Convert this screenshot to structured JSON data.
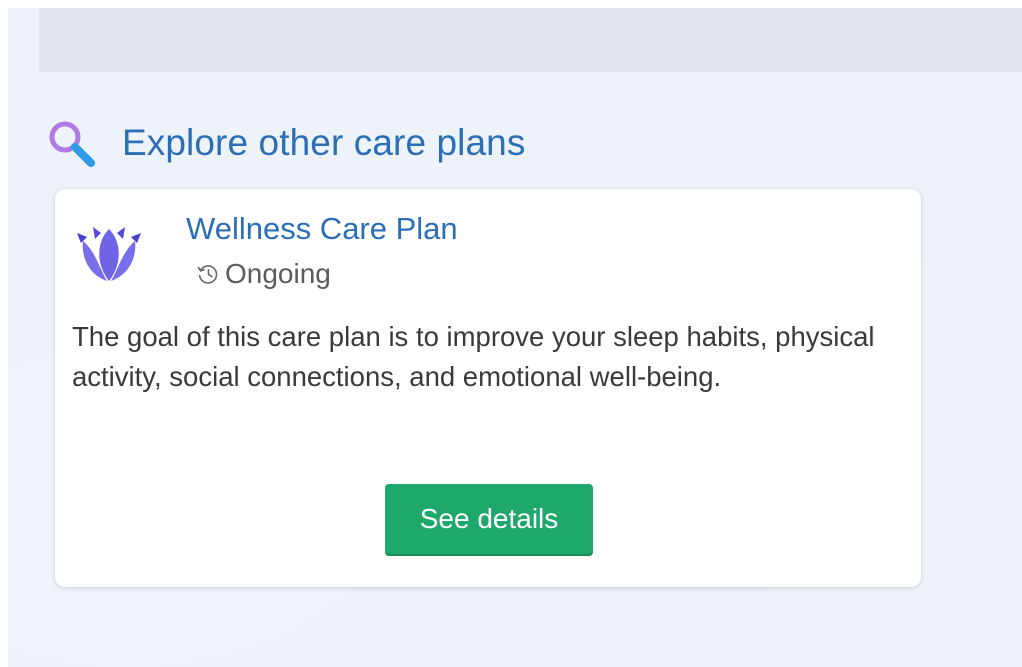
{
  "section": {
    "title": "Explore other care plans",
    "icon": "search-icon"
  },
  "card": {
    "title": "Wellness Care Plan",
    "logo_icon": "lotus-icon",
    "status": {
      "icon": "history-icon",
      "label": "Ongoing"
    },
    "description": "The goal of this care plan is to improve your sleep habits, physical activity, social connections, and emotional well-being.",
    "button_label": "See details"
  },
  "colors": {
    "accent_blue": "#2c6fb6",
    "button_green": "#1ea86b",
    "lotus_purple": "#6f63e6",
    "search_purple": "#b07be6",
    "search_blue": "#2d9be5",
    "page_background": "#eef2f9"
  }
}
